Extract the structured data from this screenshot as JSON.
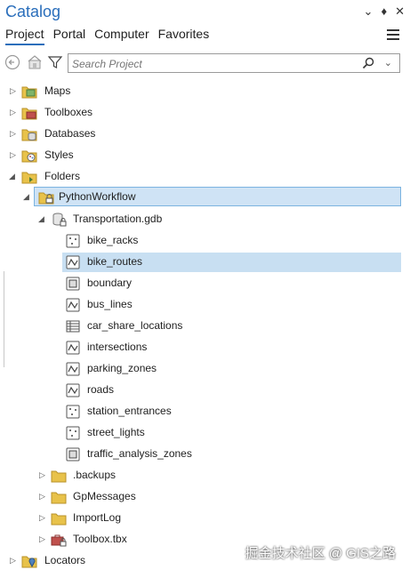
{
  "panel": {
    "title": "Catalog",
    "controls": [
      "chevron-down-icon",
      "pin-icon",
      "close-icon"
    ]
  },
  "tabs": [
    {
      "label": "Project",
      "active": true
    },
    {
      "label": "Portal",
      "active": false
    },
    {
      "label": "Computer",
      "active": false
    },
    {
      "label": "Favorites",
      "active": false
    }
  ],
  "toolbar": {
    "search_placeholder": "Search Project"
  },
  "tree": {
    "maps": "Maps",
    "toolboxes": "Toolboxes",
    "databases": "Databases",
    "styles": "Styles",
    "folders": "Folders",
    "python_workflow": "PythonWorkflow",
    "gdb": "Transportation.gdb",
    "feature_classes": [
      {
        "label": "bike_racks",
        "icon": "point-feature-icon"
      },
      {
        "label": "bike_routes",
        "icon": "line-feature-icon",
        "selected": true
      },
      {
        "label": "boundary",
        "icon": "polygon-feature-icon"
      },
      {
        "label": "bus_lines",
        "icon": "line-feature-icon"
      },
      {
        "label": "car_share_locations",
        "icon": "table-icon"
      },
      {
        "label": "intersections",
        "icon": "line-feature-icon"
      },
      {
        "label": "parking_zones",
        "icon": "line-feature-icon"
      },
      {
        "label": "roads",
        "icon": "line-feature-icon"
      },
      {
        "label": "station_entrances",
        "icon": "point-feature-icon"
      },
      {
        "label": "street_lights",
        "icon": "point-feature-icon"
      },
      {
        "label": "traffic_analysis_zones",
        "icon": "polygon-feature-icon"
      }
    ],
    "backups": ".backups",
    "gpmessages": "GpMessages",
    "importlog": "ImportLog",
    "toolbox_tbx": "Toolbox.tbx",
    "locators": "Locators"
  },
  "watermark": "掘金技术社区 @ GIS之路",
  "colors": {
    "accent": "#2a6ebb",
    "folder": "#e8c24a",
    "selection": "#c8dff2"
  }
}
